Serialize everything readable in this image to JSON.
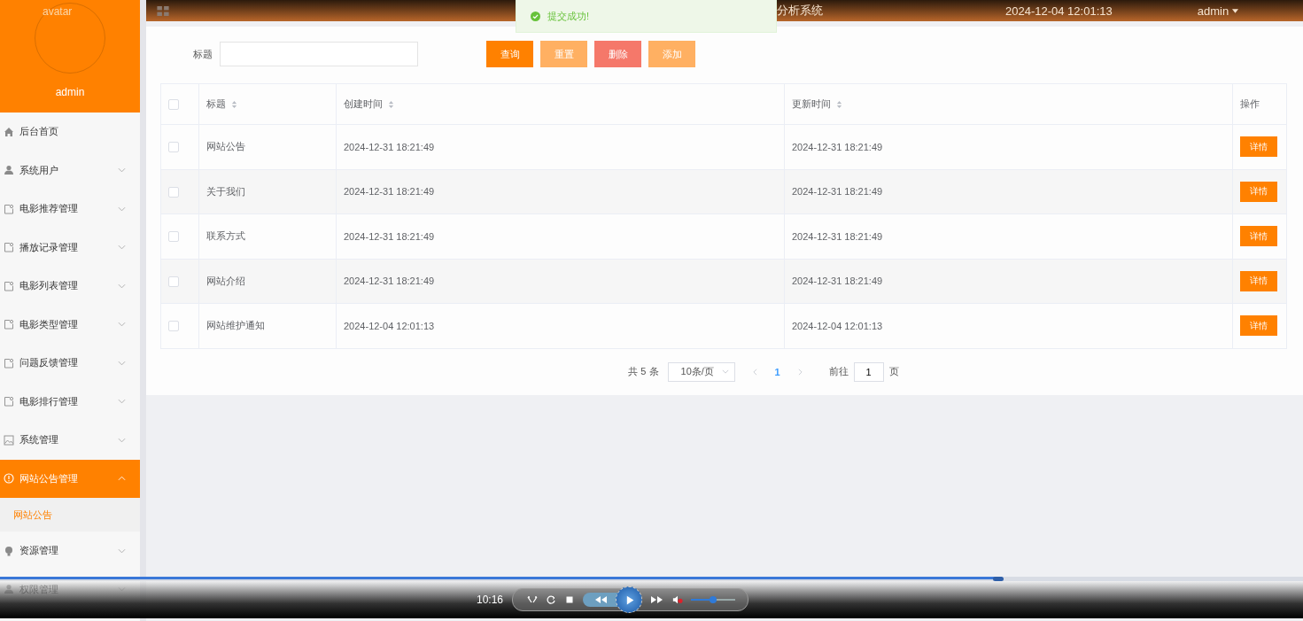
{
  "top_bar": {
    "title": "分析系统",
    "datetime": "2024-12-04 12:01:13",
    "user": "admin"
  },
  "toast": {
    "message": "提交成功!"
  },
  "sidebar": {
    "avatar_alt": "avatar",
    "username": "admin",
    "items": [
      {
        "label": "后台首页",
        "kind": "link",
        "selected": false
      },
      {
        "label": "系统用户",
        "kind": "group",
        "expanded": false,
        "selected": false
      },
      {
        "label": "电影推荐管理",
        "kind": "group",
        "expanded": false,
        "selected": false
      },
      {
        "label": "播放记录管理",
        "kind": "group",
        "expanded": false,
        "selected": false
      },
      {
        "label": "电影列表管理",
        "kind": "group",
        "expanded": false,
        "selected": false
      },
      {
        "label": "电影类型管理",
        "kind": "group",
        "expanded": false,
        "selected": false
      },
      {
        "label": "问题反馈管理",
        "kind": "group",
        "expanded": false,
        "selected": false
      },
      {
        "label": "电影排行管理",
        "kind": "group",
        "expanded": false,
        "selected": false
      },
      {
        "label": "系统管理",
        "kind": "group",
        "expanded": false,
        "selected": false
      },
      {
        "label": "网站公告管理",
        "kind": "group",
        "expanded": true,
        "selected": true,
        "children": [
          {
            "label": "网站公告",
            "selected": true
          }
        ]
      },
      {
        "label": "资源管理",
        "kind": "group",
        "expanded": false,
        "selected": false
      },
      {
        "label": "权限管理",
        "kind": "group",
        "expanded": false,
        "selected": false
      }
    ]
  },
  "search": {
    "label": "标题",
    "buttons": [
      {
        "label": "查询",
        "kind": "primary"
      },
      {
        "label": "重置",
        "kind": "light"
      },
      {
        "label": "删除",
        "kind": "danger"
      },
      {
        "label": "添加",
        "kind": "light"
      }
    ]
  },
  "table": {
    "header_checked": false,
    "columns": [
      {
        "label": "标题",
        "sortable": true
      },
      {
        "label": "创建时间",
        "sortable": true
      },
      {
        "label": "更新时间",
        "sortable": true
      },
      {
        "label": "操作",
        "sortable": false
      }
    ],
    "rows": [
      {
        "checked": false,
        "title": "网站公告",
        "created": "2024-12-31 18:21:49",
        "updated": "2024-12-31 18:21:49",
        "action": "详情"
      },
      {
        "checked": false,
        "title": "关于我们",
        "created": "2024-12-31 18:21:49",
        "updated": "2024-12-31 18:21:49",
        "action": "详情"
      },
      {
        "checked": false,
        "title": "联系方式",
        "created": "2024-12-31 18:21:49",
        "updated": "2024-12-31 18:21:49",
        "action": "详情"
      },
      {
        "checked": false,
        "title": "网站介绍",
        "created": "2024-12-31 18:21:49",
        "updated": "2024-12-31 18:21:49",
        "action": "详情"
      },
      {
        "checked": false,
        "title": "网站维护通知",
        "created": "2024-12-04 12:01:13",
        "updated": "2024-12-04 12:01:13",
        "action": "详情"
      }
    ]
  },
  "pagination": {
    "total": "共 5 条",
    "page_size": "10条/页",
    "pages": [
      {
        "label": "1",
        "selected": true
      }
    ],
    "goto_label": "前往",
    "goto_value": "1",
    "goto_unit": "页"
  },
  "player": {
    "time": "10:16",
    "progress": {
      "level": 0.766
    },
    "volume": {
      "level": 0.5
    },
    "muted": true
  }
}
